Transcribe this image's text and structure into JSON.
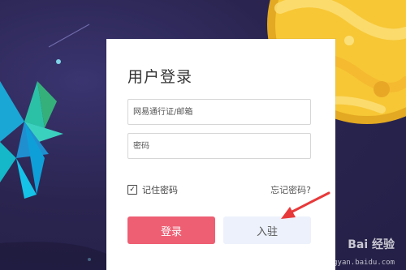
{
  "login": {
    "title": "用户登录",
    "username_placeholder": "网易通行证/邮箱",
    "password_placeholder": "密码",
    "remember_label": "记住密码",
    "remember_checked": true,
    "forgot_label": "忘记密码?",
    "login_button": "登录",
    "join_button": "入驻"
  },
  "watermark": {
    "brand": "Bai 经验",
    "url": "jingyan.baidu.com"
  },
  "colors": {
    "background": "#2a2550",
    "planet": "#f7c736",
    "login_button": "#ee5f73",
    "join_button": "#ecf1fb",
    "arrow": "#e8393a"
  }
}
